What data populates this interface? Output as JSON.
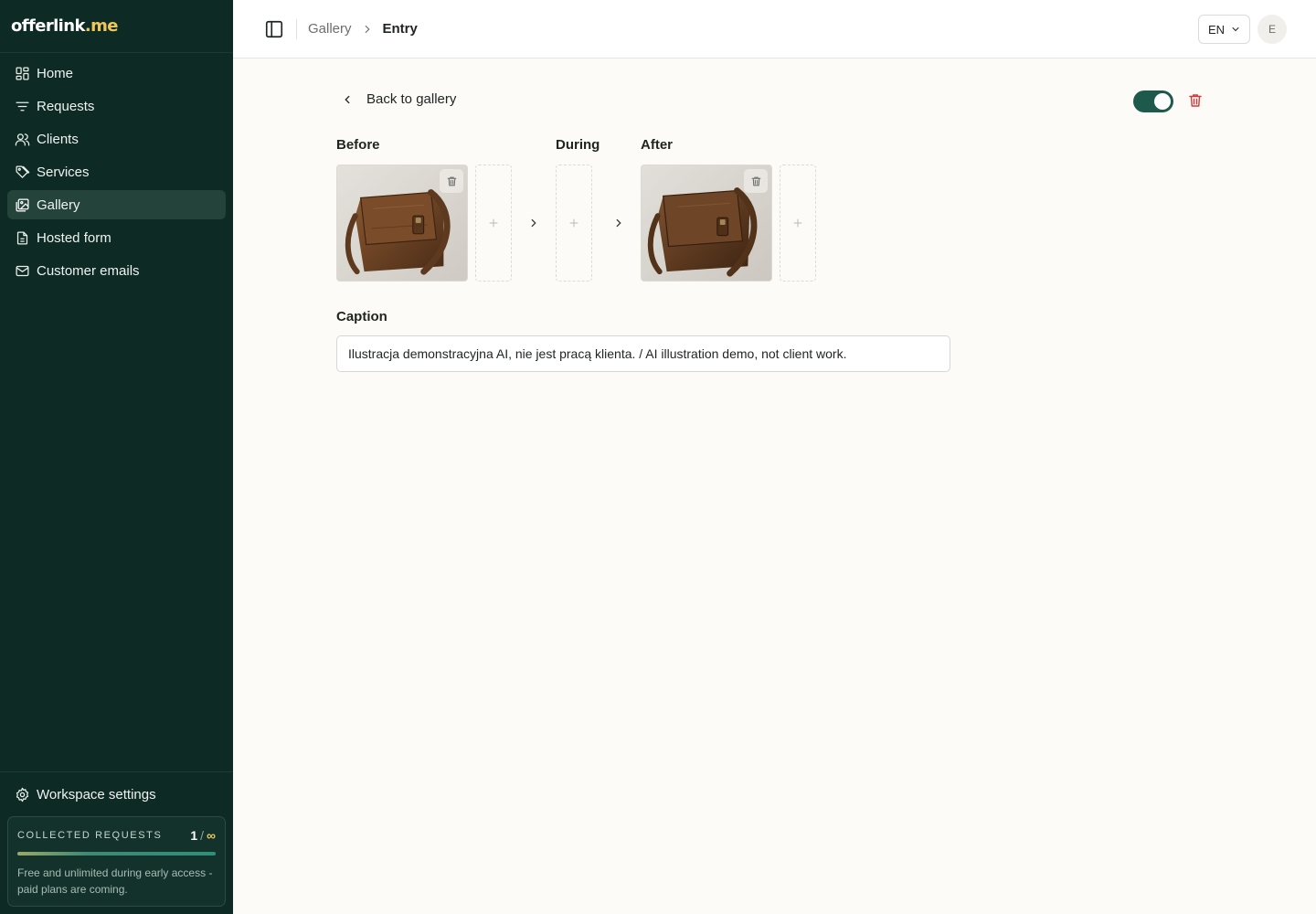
{
  "brand": {
    "name_part1": "offerlink",
    "name_part2": ".me"
  },
  "sidebar": {
    "items": [
      {
        "label": "Home",
        "icon": "grid-icon"
      },
      {
        "label": "Requests",
        "icon": "filter-icon"
      },
      {
        "label": "Clients",
        "icon": "users-icon"
      },
      {
        "label": "Services",
        "icon": "tags-icon"
      },
      {
        "label": "Gallery",
        "icon": "images-icon",
        "active": true
      },
      {
        "label": "Hosted form",
        "icon": "file-icon"
      },
      {
        "label": "Customer emails",
        "icon": "mail-icon"
      }
    ],
    "settings_label": "Workspace settings",
    "usage": {
      "title": "COLLECTED REQUESTS",
      "count": "1",
      "separator": "/",
      "limit": "∞",
      "note": "Free and unlimited during early access - paid plans are coming."
    }
  },
  "topbar": {
    "breadcrumb": {
      "parent": "Gallery",
      "current": "Entry"
    },
    "language": "EN",
    "avatar_initial": "E"
  },
  "entry": {
    "back_label": "Back to gallery",
    "published": true,
    "sections": {
      "before": "Before",
      "during": "During",
      "after": "After"
    },
    "caption_label": "Caption",
    "caption_value": "Ilustracja demonstracyjna AI, nie jest pracą klienta. / AI illustration demo, not client work."
  },
  "colors": {
    "sidebar_bg": "#0e2a24",
    "accent": "#1d5a4b",
    "brand_highlight": "#f0c85a",
    "danger": "#d23b3b"
  }
}
